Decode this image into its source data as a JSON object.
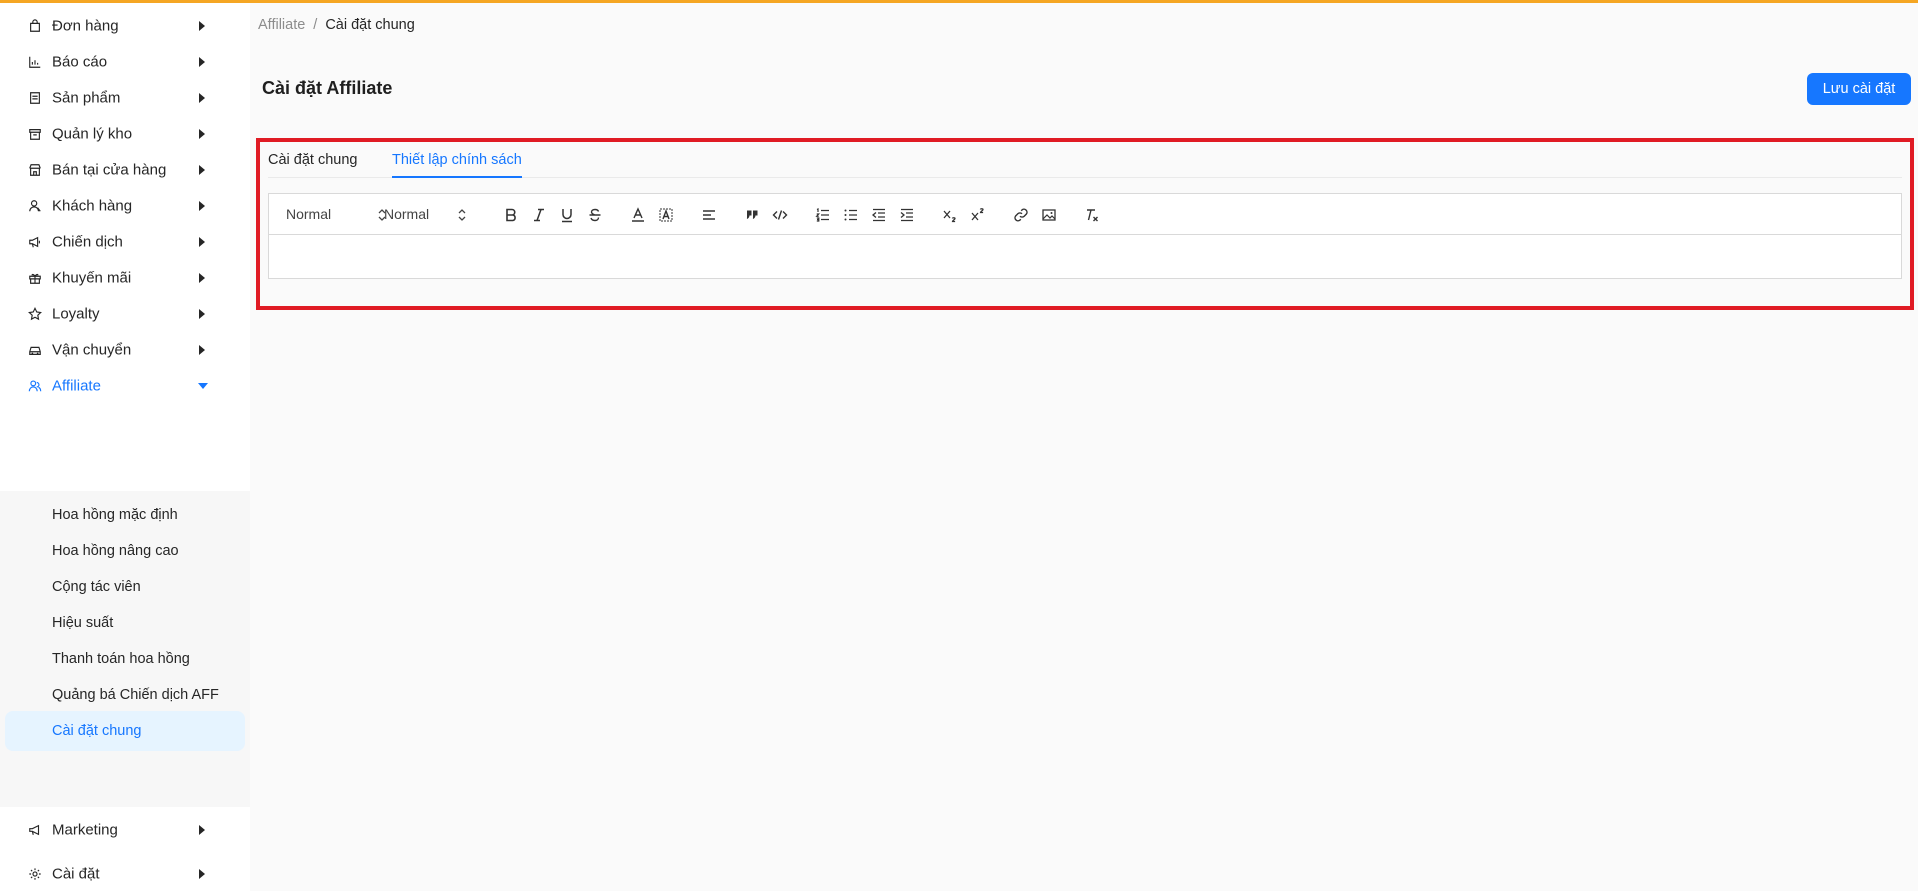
{
  "sidebar": {
    "items": [
      {
        "label": "Đơn hàng",
        "icon": "bag-icon"
      },
      {
        "label": "Báo cáo",
        "icon": "chart-icon"
      },
      {
        "label": "Sản phẩm",
        "icon": "product-icon"
      },
      {
        "label": "Quản lý kho",
        "icon": "warehouse-icon"
      },
      {
        "label": "Bán tại cửa hàng",
        "icon": "store-icon"
      },
      {
        "label": "Khách hàng",
        "icon": "customer-icon"
      },
      {
        "label": "Chiến dịch",
        "icon": "megaphone-icon"
      },
      {
        "label": "Khuyến mãi",
        "icon": "gift-icon"
      },
      {
        "label": "Loyalty",
        "icon": "star-icon"
      },
      {
        "label": "Vận chuyển",
        "icon": "car-icon"
      },
      {
        "label": "Affiliate",
        "icon": "affiliate-icon"
      },
      {
        "label": "Marketing",
        "icon": "marketing-icon"
      },
      {
        "label": "Cài đặt",
        "icon": "gear-icon"
      }
    ],
    "affiliate_submenu": [
      {
        "label": "Hoa hồng mặc định"
      },
      {
        "label": "Hoa hồng nâng cao"
      },
      {
        "label": "Cộng tác viên"
      },
      {
        "label": "Hiệu suất"
      },
      {
        "label": "Thanh toán hoa hồng"
      },
      {
        "label": "Quảng bá Chiến dịch AFF"
      },
      {
        "label": "Cài đặt chung"
      }
    ]
  },
  "breadcrumb": {
    "parent": "Affiliate",
    "separator": "/",
    "current": "Cài đặt chung"
  },
  "page": {
    "title": "Cài đặt Affiliate",
    "save_label": "Lưu cài đặt"
  },
  "tabs": [
    {
      "label": "Cài đặt chung",
      "active": false
    },
    {
      "label": "Thiết lập chính sách",
      "active": true
    }
  ],
  "editor": {
    "header_select": "Normal",
    "size_select": "Normal",
    "content": ""
  },
  "colors": {
    "accent": "#1677ff",
    "top_bar": "#f5a623",
    "highlight": "#e01b24"
  }
}
